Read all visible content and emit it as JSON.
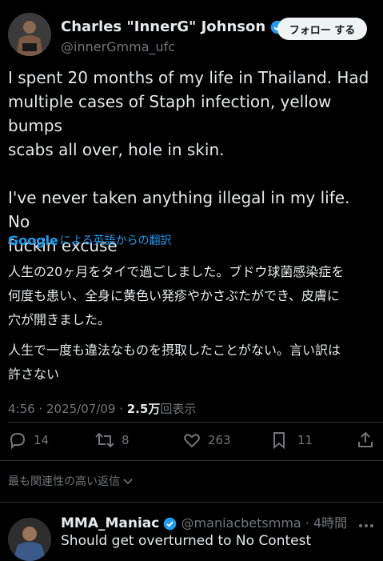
{
  "author": {
    "name": "Charles \"InnerG\" Johnson",
    "handle": "@innerGmma_ufc",
    "avatar_icon": "user-avatar-fighter",
    "verified_color": "#1d9bf0"
  },
  "follow_button": "フォロー する",
  "tweet": {
    "line1": "I spent 20 months of my life in Thailand. Had",
    "line2": "multiple cases of Staph infection, yellow bumps",
    "line3": "scabs all over, hole in skin.",
    "line4": "I've never taken anything illegal in my life. No",
    "line5": "fuckin excuse"
  },
  "translation": {
    "google_word": "Google",
    "label": "による英語からの翻訳",
    "line1": "人生の20ヶ月をタイで過ごしました。ブドウ球菌感染症を",
    "line2": "何度も患い、全身に黄色い発疹やかさぶたができ、皮膚に",
    "line3": "穴が開きました。",
    "line4": "人生で一度も違法なものを摂取したことがない。言い訳は",
    "line5": "許さない"
  },
  "meta": {
    "time_date": "4:56 · 2025/07/09 · ",
    "views_count": "2.5万",
    "views_label": "回表示"
  },
  "actions": {
    "replies": "14",
    "retweets": "8",
    "likes": "263",
    "bookmarks": "11"
  },
  "sort_label": "最も関連性の高い返信",
  "reply": {
    "name": "MMA_Maniac",
    "handle": "@maniacbetsmma",
    "time": "4時間",
    "text": "Should get overturned to No Contest"
  }
}
